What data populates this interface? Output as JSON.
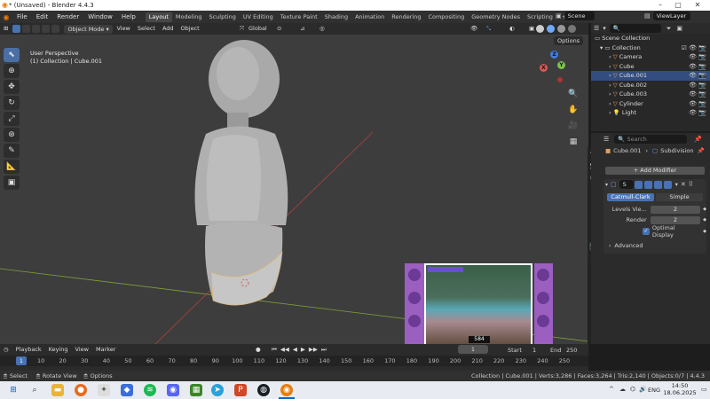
{
  "window": {
    "title": "* (Unsaved) - Blender 4.4.3"
  },
  "menu": [
    "File",
    "Edit",
    "Render",
    "Window",
    "Help"
  ],
  "workspaces": [
    "Layout",
    "Modeling",
    "Sculpting",
    "UV Editing",
    "Texture Paint",
    "Shading",
    "Animation",
    "Rendering",
    "Compositing",
    "Geometry Nodes",
    "Scripting"
  ],
  "scene": {
    "label": "Scene",
    "view_layer": "ViewLayer"
  },
  "viewport_header": {
    "mode": "Object Mode",
    "items": [
      "View",
      "Select",
      "Add",
      "Object"
    ],
    "transform": "Global",
    "options_label": "Options"
  },
  "viewport": {
    "perspective": "User Perspective",
    "context": "(1) Collection | Cube.001"
  },
  "outliner": {
    "search_placeholder": "",
    "scene_collection": "Scene Collection",
    "collection": "Collection",
    "items": [
      "Camera",
      "Cube",
      "Cube.001",
      "Cube.002",
      "Cube.003",
      "Cylinder",
      "Light"
    ]
  },
  "properties": {
    "search_placeholder": "Search",
    "object": "Cube.001",
    "modifier_crumb": "Subdivision",
    "add_modifier": "Add Modifier",
    "modifier_short": "S",
    "catmull": "Catmull-Clark",
    "simple": "Simple",
    "levels_label": "Levels Vie...",
    "levels_value": "2",
    "render_label": "Render",
    "render_value": "2",
    "optimal_display": "Optimal Display",
    "advanced": "Advanced"
  },
  "timeline": {
    "items": [
      "Playback",
      "Keying",
      "View",
      "Marker"
    ],
    "current_frame": "1",
    "start_label": "Start",
    "start": "1",
    "end_label": "End",
    "end": "250",
    "frames": [
      "1",
      "10",
      "20",
      "30",
      "40",
      "50",
      "60",
      "70",
      "80",
      "90",
      "100",
      "110",
      "120",
      "130",
      "140",
      "150",
      "160",
      "170",
      "180",
      "190",
      "200",
      "210",
      "220",
      "230",
      "240",
      "250"
    ]
  },
  "overlay": {
    "score": "584"
  },
  "statusbar": {
    "select": "Select",
    "rotate": "Rotate View",
    "options": "Options",
    "stats": "Collection | Cube.001 | Verts:3,286 | Faces:3,264 | Tris:2,140 | Objects:0/7 | 4.4.3"
  },
  "taskbar": {
    "lang": "ENG",
    "time": "14:50",
    "date": "18.06.2025"
  },
  "colors": {
    "accent": "#4772b3",
    "x_axis": "#c0392b",
    "y_axis": "#8fb33a",
    "gizmo_x": "#e05555",
    "gizmo_y": "#7cc24a",
    "gizmo_z": "#3f7de0"
  }
}
